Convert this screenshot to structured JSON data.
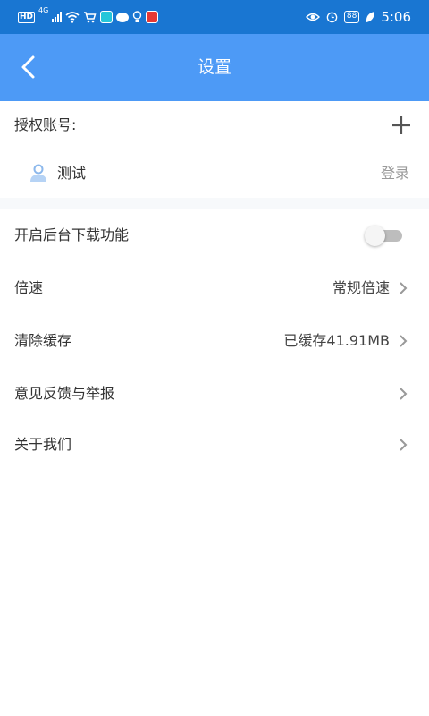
{
  "status_bar": {
    "left_icons": [
      "hd-icon",
      "network-4g-icon",
      "signal-icon",
      "wifi-icon",
      "cart-icon",
      "search-app-icon",
      "chat-bubble-icon",
      "bulb-icon",
      "red-app-icon"
    ],
    "hd": "HD",
    "network": "4G",
    "battery": "88",
    "time": "5:06"
  },
  "header": {
    "title": "设置",
    "back_icon": "back-arrow-icon",
    "background": "#4d9af6"
  },
  "auth": {
    "label": "授权账号:",
    "add_icon": "plus-icon",
    "account": {
      "name": "测试",
      "action": "登录",
      "icon": "user-icon"
    }
  },
  "settings": {
    "background_download": {
      "label": "开启后台下载功能",
      "enabled": false
    },
    "speed": {
      "label": "倍速",
      "value": "常规倍速"
    },
    "clear_cache": {
      "label": "清除缓存",
      "value": "已缓存41.91MB"
    },
    "feedback": {
      "label": "意见反馈与举报"
    },
    "about": {
      "label": "关于我们"
    }
  },
  "colors": {
    "status_bar": "#1976d2",
    "accent": "#4d9af6",
    "text": "#333333",
    "muted": "#9a9a9a"
  }
}
